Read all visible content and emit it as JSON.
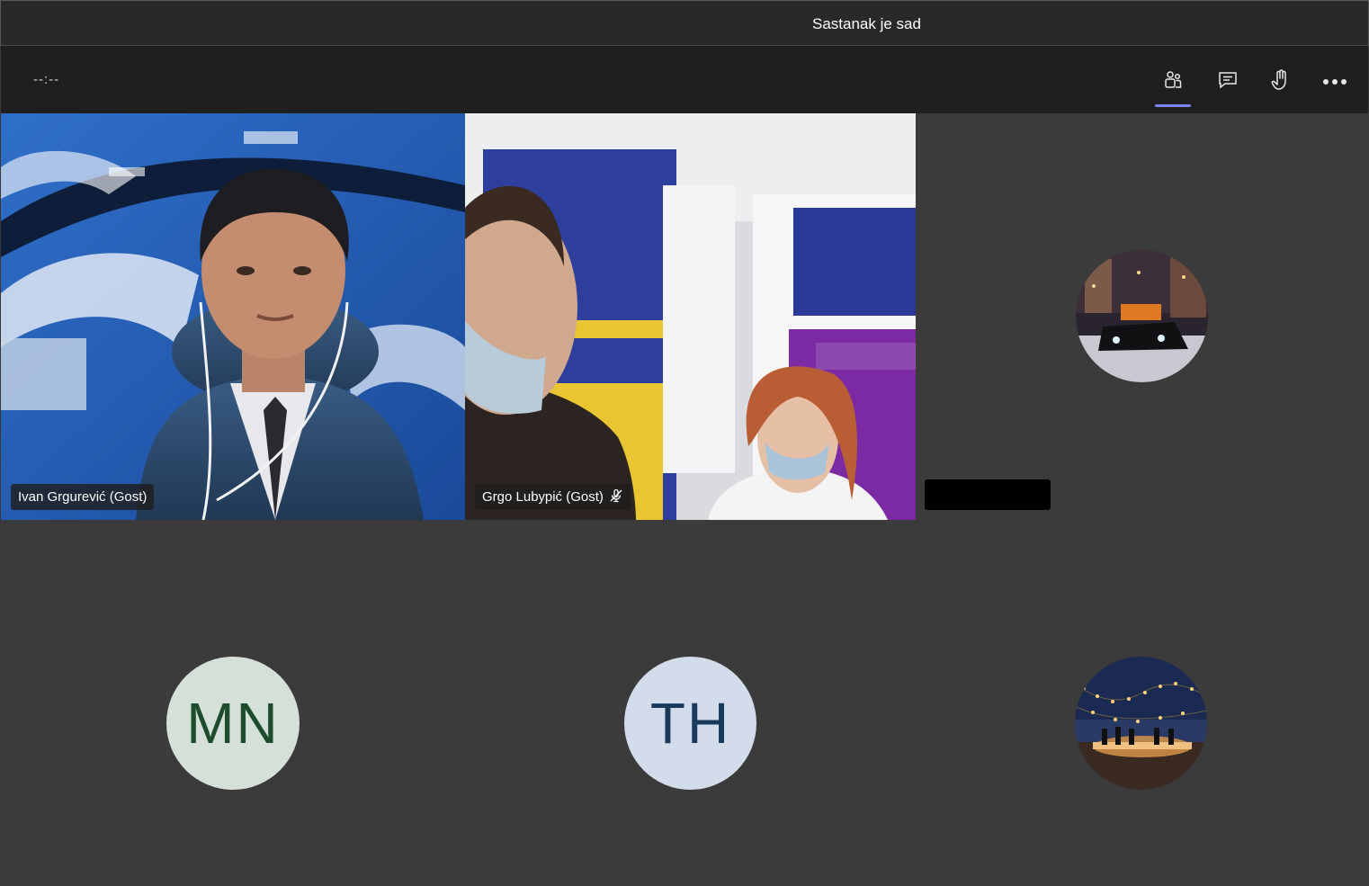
{
  "window": {
    "title": "Sastanak je sad"
  },
  "toolbar": {
    "timer": "--:--",
    "buttons": [
      {
        "icon": "participants-icon",
        "active": true
      },
      {
        "icon": "chat-icon",
        "active": false
      },
      {
        "icon": "raise-hand-icon",
        "active": false
      },
      {
        "icon": "more-options-icon",
        "active": false
      }
    ],
    "accent_color": "#7f85f5"
  },
  "participants": [
    {
      "name": "Ivan Grgurević (Gost)",
      "kind": "video",
      "muted": false
    },
    {
      "name": "Grgo Lubурić (Gost)",
      "kind": "video",
      "muted": true
    },
    {
      "name": "",
      "kind": "photo-avatar",
      "photo": "night-street-car",
      "redacted": true
    },
    {
      "initials": "MN",
      "kind": "initials",
      "bg_color": "#d4e0d8",
      "fg_color": "#1e4d2e"
    },
    {
      "initials": "TH",
      "kind": "initials",
      "bg_color": "#d3dceb",
      "fg_color": "#1a3a5c"
    },
    {
      "kind": "photo-avatar",
      "photo": "lights-dinner-beach"
    }
  ]
}
